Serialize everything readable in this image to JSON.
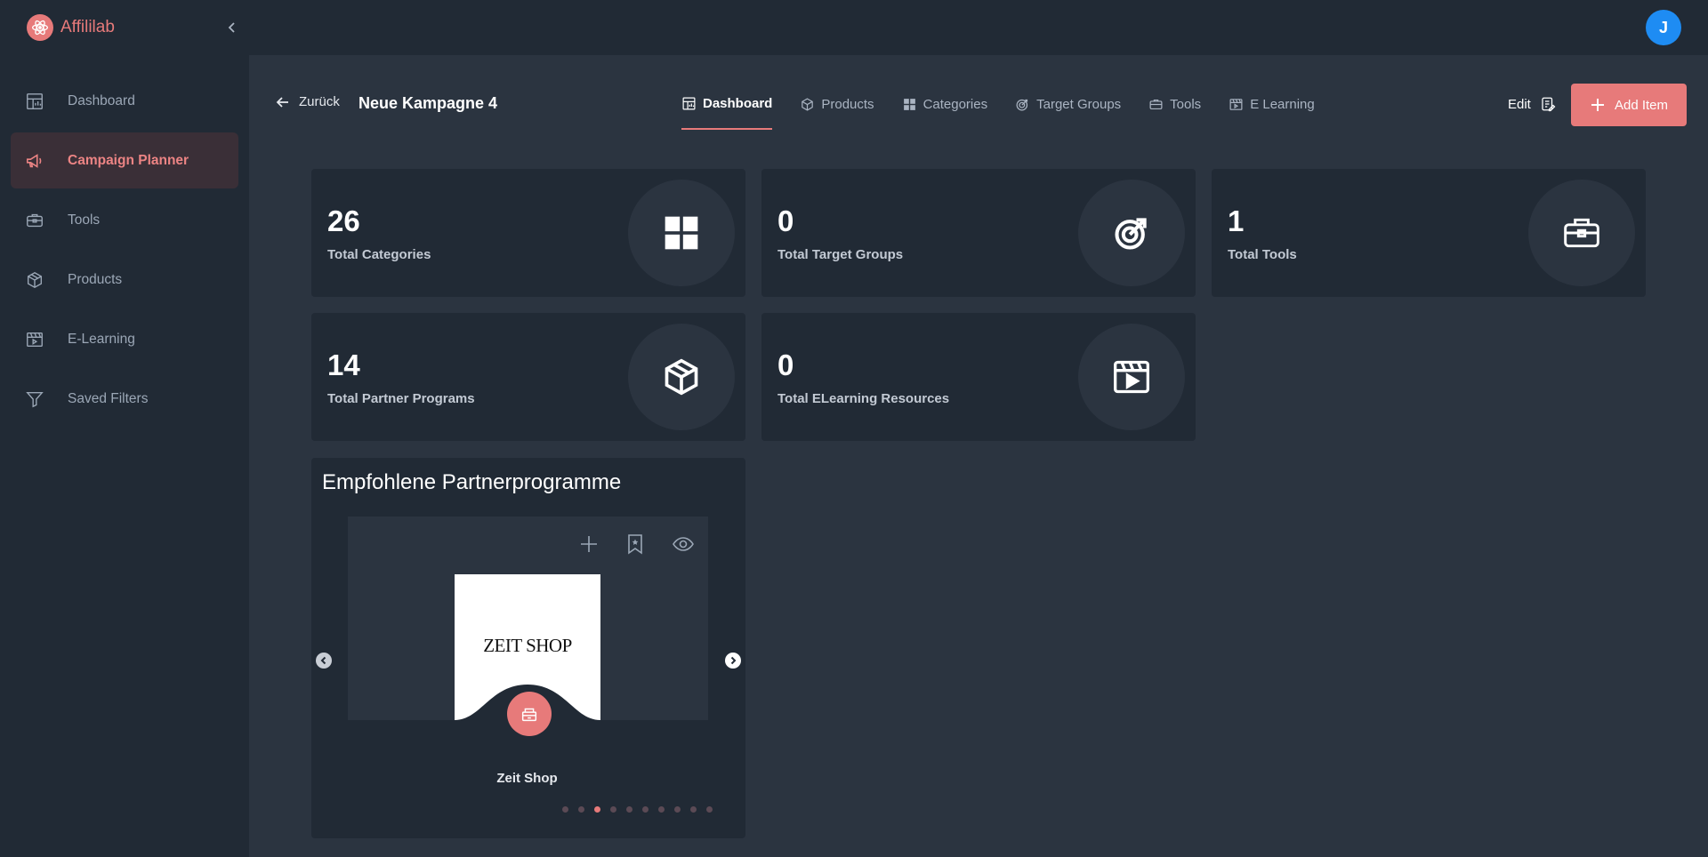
{
  "brand": {
    "name": "Affililab"
  },
  "user": {
    "initial": "J"
  },
  "sidebar": {
    "items": [
      {
        "label": "Dashboard",
        "icon": "dashboard-icon",
        "active": false
      },
      {
        "label": "Campaign Planner",
        "icon": "megaphone-icon",
        "active": true
      },
      {
        "label": "Tools",
        "icon": "toolbox-icon",
        "active": false
      },
      {
        "label": "Products",
        "icon": "box-icon",
        "active": false
      },
      {
        "label": "E-Learning",
        "icon": "film-icon",
        "active": false
      },
      {
        "label": "Saved Filters",
        "icon": "filter-icon",
        "active": false
      }
    ]
  },
  "header": {
    "back_label": "Zurück",
    "title": "Neue Kampagne 4",
    "tabs": [
      {
        "label": "Dashboard",
        "icon": "dashboard-icon",
        "active": true
      },
      {
        "label": "Products",
        "icon": "box-icon",
        "active": false
      },
      {
        "label": "Categories",
        "icon": "grid-icon",
        "active": false
      },
      {
        "label": "Target Groups",
        "icon": "target-icon",
        "active": false
      },
      {
        "label": "Tools",
        "icon": "toolbox-icon",
        "active": false
      },
      {
        "label": "E Learning",
        "icon": "film-icon",
        "active": false
      }
    ],
    "edit_label": "Edit",
    "add_label": "Add Item"
  },
  "stats": [
    {
      "value": "26",
      "label": "Total Categories",
      "icon": "grid-icon"
    },
    {
      "value": "0",
      "label": "Total Target Groups",
      "icon": "target-icon"
    },
    {
      "value": "1",
      "label": "Total Tools",
      "icon": "toolbox-icon"
    },
    {
      "value": "14",
      "label": "Total Partner Programs",
      "icon": "box-icon"
    },
    {
      "value": "0",
      "label": "Total ELearning Resources",
      "icon": "film-icon"
    }
  ],
  "recommended": {
    "title": "Empfohlene Partnerprogramme",
    "current_item": {
      "name": "Zeit Shop",
      "logo_text": "ZEIT SHOP"
    },
    "dots_count": 10,
    "active_dot": 3
  },
  "colors": {
    "accent": "#e77a7a",
    "sidebar_bg": "#212a35",
    "main_bg": "#2b3440",
    "avatar": "#1e8cf3"
  }
}
